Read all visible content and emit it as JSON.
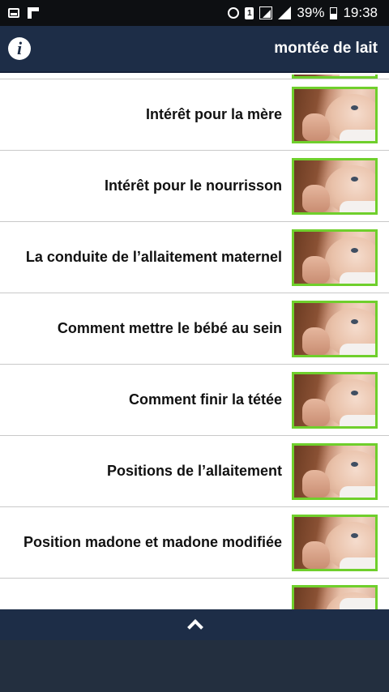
{
  "status_bar": {
    "battery_percent": "39%",
    "time": "19:38",
    "sim_label": "1",
    "icons": [
      "image-notification-icon",
      "flipboard-icon",
      "alarm-icon",
      "sim-icon",
      "signal-box-icon",
      "signal-icon",
      "battery-icon"
    ]
  },
  "header": {
    "info_label": "i",
    "title": "montée de lait"
  },
  "list": {
    "items": [
      {
        "label": ""
      },
      {
        "label": "Intérêt  pour la mère"
      },
      {
        "label": "Intérêt pour le nourrisson"
      },
      {
        "label": "La conduite de l’allaitement maternel"
      },
      {
        "label": "Comment mettre le bébé au sein"
      },
      {
        "label": "Comment finir la tétée"
      },
      {
        "label": "Positions de l’allaitement"
      },
      {
        "label": "Position madone et madone modifiée"
      },
      {
        "label": ""
      }
    ],
    "thumbnail_border_color": "#6fcf2c"
  },
  "colors": {
    "header_bg": "#1d2d47",
    "status_bg": "#0d0f12",
    "footer_bg": "#232f3f"
  }
}
